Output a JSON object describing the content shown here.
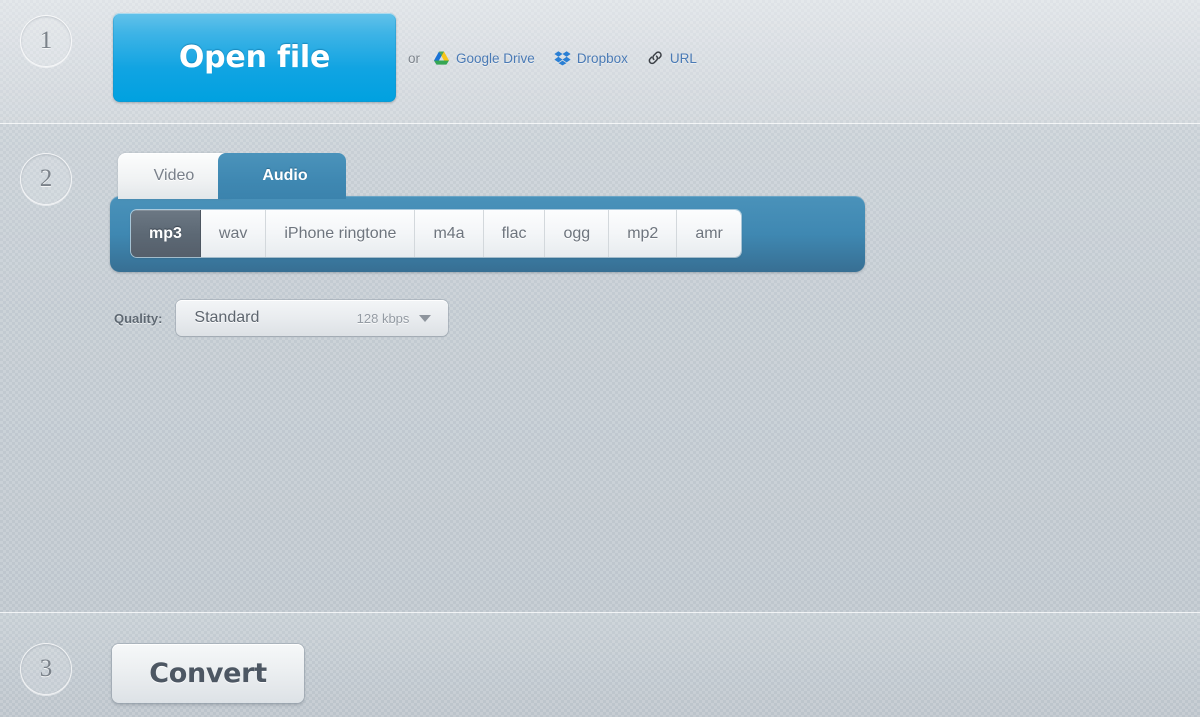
{
  "steps": {
    "one": "1",
    "two": "2",
    "three": "3"
  },
  "open_section": {
    "open_file_label": "Open file",
    "or_label": "or",
    "sources": [
      {
        "label": "Google Drive",
        "icon": "google-drive-icon"
      },
      {
        "label": "Dropbox",
        "icon": "dropbox-icon"
      },
      {
        "label": "URL",
        "icon": "link-icon"
      }
    ]
  },
  "format_section": {
    "tabs": [
      {
        "label": "Video",
        "active": false
      },
      {
        "label": "Audio",
        "active": true
      }
    ],
    "formats": [
      {
        "label": "mp3",
        "selected": true
      },
      {
        "label": "wav",
        "selected": false
      },
      {
        "label": "iPhone ringtone",
        "selected": false
      },
      {
        "label": "m4a",
        "selected": false
      },
      {
        "label": "flac",
        "selected": false
      },
      {
        "label": "ogg",
        "selected": false
      },
      {
        "label": "mp2",
        "selected": false
      },
      {
        "label": "amr",
        "selected": false
      }
    ],
    "quality": {
      "label": "Quality:",
      "value": "Standard",
      "bitrate": "128 kbps",
      "caret_icon": "chevron-down-icon"
    }
  },
  "convert_section": {
    "convert_label": "Convert"
  },
  "colors": {
    "accent_blue": "#00a1e0",
    "tab_blue": "#3f88b2",
    "panel_blue": "#3f88b2",
    "selected_format": "#5d6975",
    "link_blue": "#4a7ab5",
    "background": "#bfc7ce",
    "top_background": "#d6dbe0"
  }
}
